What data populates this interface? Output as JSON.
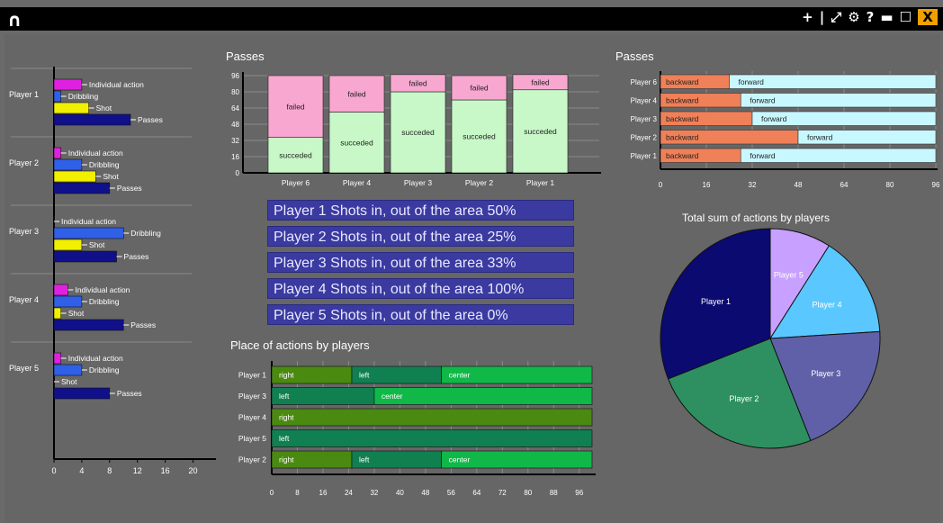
{
  "window": {
    "logo": "∩",
    "toolbar_icons": [
      "plus-icon",
      "pipe-icon",
      "resize-icon",
      "gear-icon",
      "help-icon",
      "minimize-icon",
      "maximize-icon",
      "close-icon"
    ],
    "toolbar_glyphs": [
      "+",
      "|",
      "⤢",
      "⚙",
      "?",
      "▬",
      "☐",
      "X"
    ]
  },
  "shots": [
    "Player 1 Shots in, out of the area 50%",
    "Player 2 Shots in, out of the area 25%",
    "Player 3 Shots in, out of the area 33%",
    "Player 4 Shots in, out of the area 100%",
    "Player 5 Shots in, out of the area 0%"
  ],
  "colors": {
    "individual": "#e020e0",
    "dribbling": "#3060e8",
    "shot": "#f0f000",
    "passes": "#10108a",
    "failed": "#f8a8d0",
    "succeeded": "#c8f8c8",
    "backward": "#f08058",
    "forward": "#c8f8ff",
    "right": "#4a8a10",
    "left": "#108050",
    "center": "#10b848"
  },
  "chart_data": [
    {
      "id": "actions",
      "type": "bar",
      "orientation": "horizontal",
      "categories": [
        "Player 1",
        "Player 2",
        "Player 3",
        "Player 4",
        "Player 5"
      ],
      "series": [
        {
          "name": "Individual action",
          "values": [
            4,
            1,
            0,
            2,
            1
          ]
        },
        {
          "name": "Dribbling",
          "values": [
            1,
            4,
            10,
            4,
            4
          ]
        },
        {
          "name": "Shot",
          "values": [
            5,
            6,
            4,
            1,
            0
          ]
        },
        {
          "name": "Passes",
          "values": [
            11,
            8,
            9,
            10,
            8
          ]
        }
      ],
      "xticks": [
        0,
        4,
        8,
        12,
        16,
        20
      ],
      "xlim": [
        0,
        22
      ]
    },
    {
      "id": "passes_vertical",
      "type": "bar",
      "stacked": true,
      "title": "Passes",
      "categories": [
        "Player 6",
        "Player 4",
        "Player 3",
        "Player 2",
        "Player 1"
      ],
      "series": [
        {
          "name": "succeded",
          "values": [
            35,
            60,
            80,
            72,
            82
          ]
        },
        {
          "name": "failed",
          "values": [
            61,
            36,
            17,
            24,
            15
          ]
        }
      ],
      "yticks": [
        0,
        16,
        32,
        48,
        64,
        80,
        96
      ],
      "ylim": [
        0,
        96
      ]
    },
    {
      "id": "passes_horizontal",
      "type": "bar",
      "stacked": true,
      "orientation": "horizontal",
      "title": "Passes",
      "categories": [
        "Player 6",
        "Player 4",
        "Player 3",
        "Player 2",
        "Player 1"
      ],
      "series": [
        {
          "name": "backward",
          "values": [
            24,
            28,
            32,
            48,
            28
          ]
        },
        {
          "name": "forward",
          "values": [
            72,
            68,
            64,
            48,
            68
          ]
        }
      ],
      "xticks": [
        0,
        16,
        32,
        48,
        64,
        80,
        96
      ],
      "xlim": [
        0,
        96
      ]
    },
    {
      "id": "place",
      "type": "bar",
      "stacked": true,
      "orientation": "horizontal",
      "title": "Place of actions by players",
      "categories": [
        "Player 1",
        "Player 3",
        "Player 4",
        "Player 5",
        "Player 2"
      ],
      "segments": [
        [
          {
            "label": "right",
            "value": 25
          },
          {
            "label": "left",
            "value": 28
          },
          {
            "label": "center",
            "value": 47
          }
        ],
        [
          {
            "label": "left",
            "value": 32
          },
          {
            "label": "center",
            "value": 68
          }
        ],
        [
          {
            "label": "right",
            "value": 100
          }
        ],
        [
          {
            "label": "left",
            "value": 100
          }
        ],
        [
          {
            "label": "right",
            "value": 25
          },
          {
            "label": "left",
            "value": 28
          },
          {
            "label": "center",
            "value": 47
          }
        ]
      ],
      "xticks": [
        0,
        8,
        16,
        24,
        32,
        40,
        48,
        56,
        64,
        72,
        80,
        88,
        96
      ],
      "xlim": [
        0,
        100
      ]
    },
    {
      "id": "pie",
      "type": "pie",
      "title": "Total sum of actions by players",
      "slices": [
        {
          "label": "Player 5",
          "value": 9,
          "color": "#c8a0ff"
        },
        {
          "label": "Player 4",
          "value": 15,
          "color": "#5ac8ff"
        },
        {
          "label": "Player 3",
          "value": 20,
          "color": "#6060a8"
        },
        {
          "label": "Player 2",
          "value": 25,
          "color": "#2e9060"
        },
        {
          "label": "Player 1",
          "value": 31,
          "color": "#0a0a70"
        }
      ]
    }
  ]
}
